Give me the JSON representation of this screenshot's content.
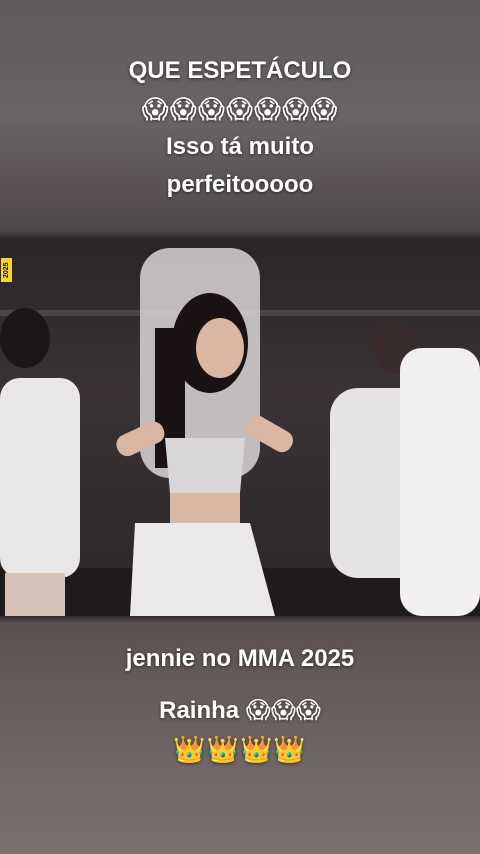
{
  "top_caption": {
    "line1": "QUE ESPETÁCULO",
    "emojis": "😱😱😱😱😱😱😱",
    "line2": "Isso tá muito",
    "line3": "perfeitooooo"
  },
  "video": {
    "badge": "2025"
  },
  "bottom_caption": {
    "line1": "jennie no MMA 2025",
    "line2": "Rainha 😱😱😱",
    "crowns": "👑👑👑👑"
  }
}
